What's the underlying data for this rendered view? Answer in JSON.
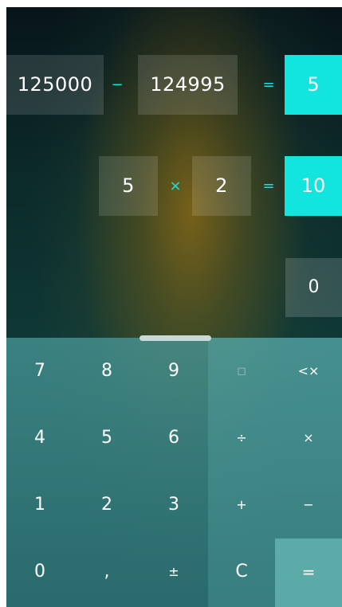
{
  "history": [
    {
      "left": "125000",
      "operator": "−",
      "right": "124995",
      "equals": "=",
      "result": "5"
    },
    {
      "left": "5",
      "operator": "×",
      "right": "2",
      "equals": "=",
      "result": "10"
    }
  ],
  "display": {
    "current": "0"
  },
  "keypad": {
    "row1": [
      "7",
      "8",
      "9",
      "◻",
      "<×"
    ],
    "row2": [
      "4",
      "5",
      "6",
      "÷",
      "×"
    ],
    "row3": [
      "1",
      "2",
      "3",
      "+",
      "−"
    ],
    "row4": [
      "0",
      ",",
      "±",
      "C",
      "="
    ]
  },
  "colors": {
    "accent": "#12e4de",
    "keypad_bg": "#3f8f8f"
  },
  "icons": {
    "memory": "memory-icon",
    "backspace": "backspace-icon"
  }
}
